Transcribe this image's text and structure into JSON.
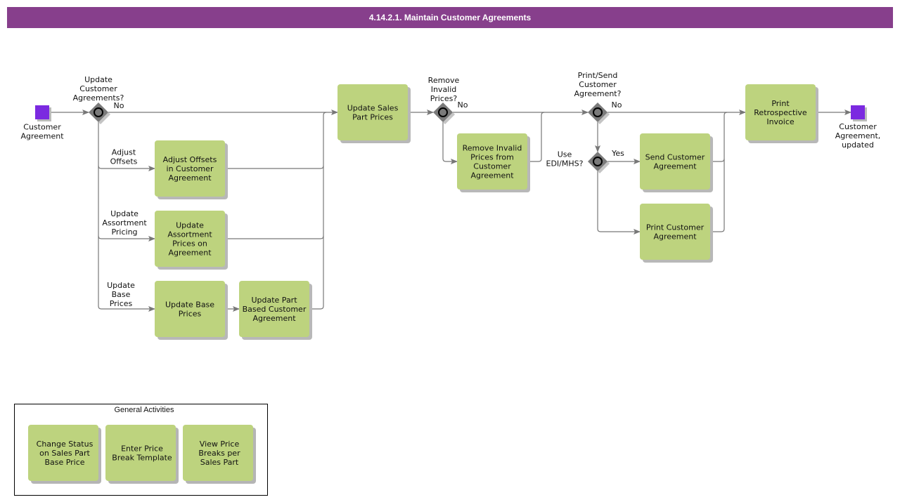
{
  "title": "4.14.2.1. Maintain Customer Agreements",
  "colors": {
    "title_bar": "#873f8c",
    "task_fill": "#bdd37e",
    "event_fill": "#7b2ae0",
    "gateway_fill": "#7a7a7a",
    "flow_line": "#777777"
  },
  "events": {
    "start": {
      "label": [
        "Customer",
        "Agreement"
      ],
      "icon": "start-event-square"
    },
    "end": {
      "label": [
        "Customer",
        "Agreement,",
        "updated"
      ],
      "icon": "end-event-square"
    }
  },
  "gateways": {
    "g1": {
      "label": [
        "Update",
        "Customer",
        "Agreements?"
      ],
      "out_label": "No",
      "icon": "exclusive-gateway-icon"
    },
    "g2": {
      "label": [
        "Remove",
        "Invalid",
        "Prices?"
      ],
      "out_label": "No",
      "icon": "exclusive-gateway-icon"
    },
    "g3": {
      "label": [
        "Print/Send",
        "Customer",
        "Agreement?"
      ],
      "out_label": "No",
      "icon": "exclusive-gateway-icon"
    },
    "g4": {
      "label": [
        "Use",
        "EDI/MHS?"
      ],
      "out_label": "Yes",
      "icon": "exclusive-gateway-icon"
    }
  },
  "flow_labels": {
    "adjust_offsets": [
      "Adjust",
      "Offsets"
    ],
    "update_assortment": [
      "Update",
      "Assortment",
      "Pricing"
    ],
    "update_base": [
      "Update",
      "Base",
      "Prices"
    ]
  },
  "tasks": {
    "adjust_offsets": [
      "Adjust Offsets",
      "in Customer",
      "Agreement"
    ],
    "update_assortment": [
      "Update",
      "Assortment",
      "Prices on",
      "Agreement"
    ],
    "update_base": [
      "Update Base",
      "Prices"
    ],
    "update_part_based": [
      "Update Part",
      "Based Customer",
      "Agreement"
    ],
    "update_sales_part": [
      "Update Sales",
      "Part Prices"
    ],
    "remove_invalid": [
      "Remove Invalid",
      "Prices from",
      "Customer",
      "Agreement"
    ],
    "send_customer": [
      "Send Customer",
      "Agreement"
    ],
    "print_customer": [
      "Print Customer",
      "Agreement"
    ],
    "print_retro": [
      "Print",
      "Retrospective",
      "Invoice"
    ]
  },
  "general_activities": {
    "title": "General Activities",
    "items": [
      [
        "Change Status",
        "on Sales Part",
        "Base Price"
      ],
      [
        "Enter Price",
        "Break Template"
      ],
      [
        "View Price",
        "Breaks per",
        "Sales Part"
      ]
    ]
  }
}
